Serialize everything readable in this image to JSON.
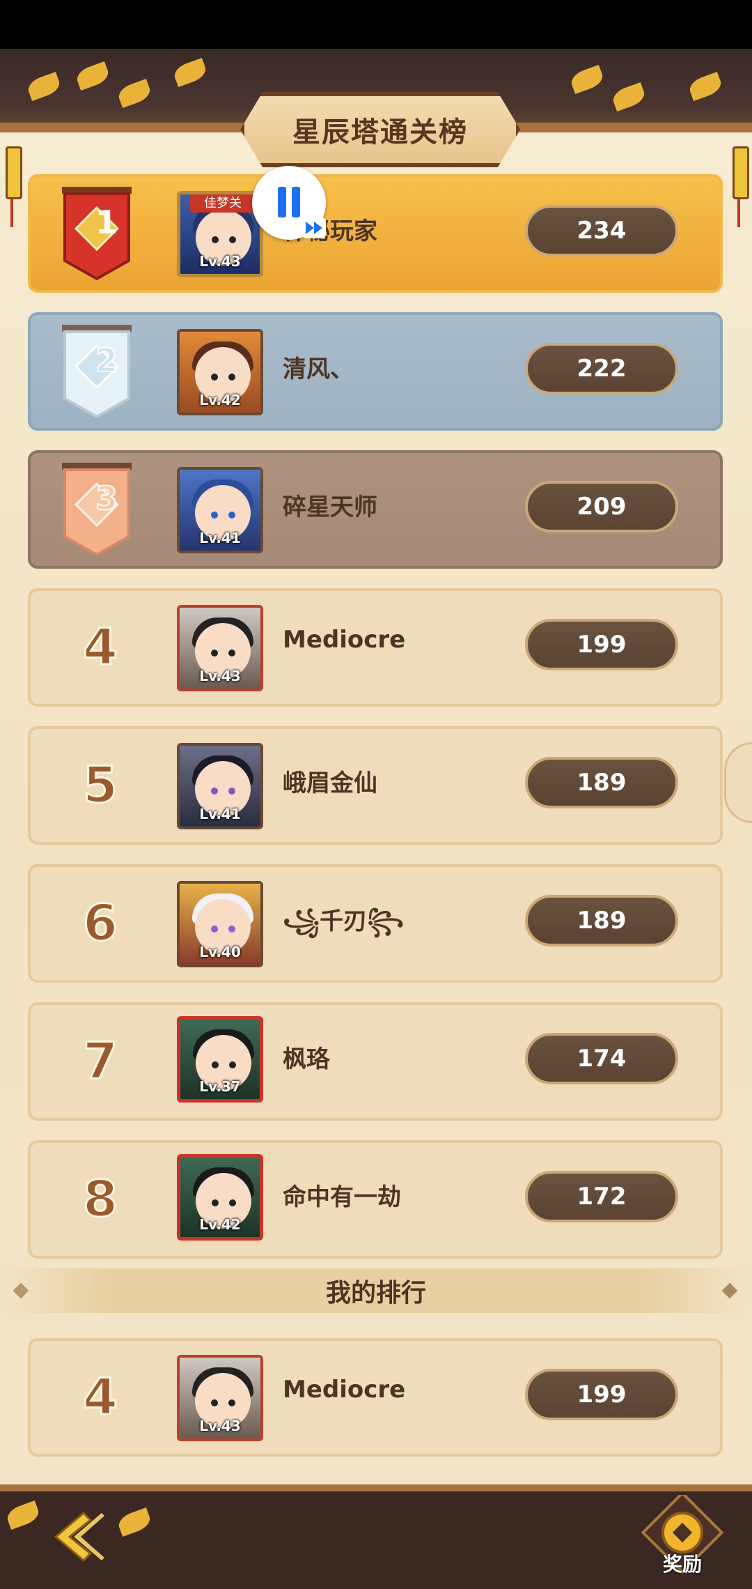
{
  "title": "星辰塔通关榜",
  "overlay": {
    "tag": "佳梦关"
  },
  "rows": [
    {
      "rank": "1",
      "name": "神秘玩家",
      "level": "Lv.43",
      "score": "234"
    },
    {
      "rank": "2",
      "name": "清风、",
      "level": "Lv.42",
      "score": "222"
    },
    {
      "rank": "3",
      "name": "碎星天师",
      "level": "Lv.41",
      "score": "209"
    },
    {
      "rank": "4",
      "name": "Mediocre",
      "level": "Lv.43",
      "score": "199"
    },
    {
      "rank": "5",
      "name": "峨眉金仙",
      "level": "Lv.41",
      "score": "189"
    },
    {
      "rank": "6",
      "name": "꧁千刃꧂",
      "level": "Lv.40",
      "score": "189"
    },
    {
      "rank": "7",
      "name": "枫珞",
      "level": "Lv.37",
      "score": "174"
    },
    {
      "rank": "8",
      "name": "命中有一劫",
      "level": "Lv.42",
      "score": "172"
    }
  ],
  "my_rank_section": {
    "label": "我的排行"
  },
  "my_row": {
    "rank": "4",
    "name": "Mediocre",
    "level": "Lv.43",
    "score": "199"
  },
  "bottom": {
    "reward_label": "奖励"
  },
  "icons": {
    "back": "back-arrow-icon",
    "reward": "reward-coin-icon",
    "pause": "pause-icon",
    "fast_forward": "fast-forward-icon"
  },
  "colors": {
    "gold": "#f2b23c",
    "silver": "#a3b7c6",
    "bronze": "#a88e7a",
    "row": "#efdcbb",
    "score_pill": "#5e4636",
    "text": "#4e3424"
  }
}
